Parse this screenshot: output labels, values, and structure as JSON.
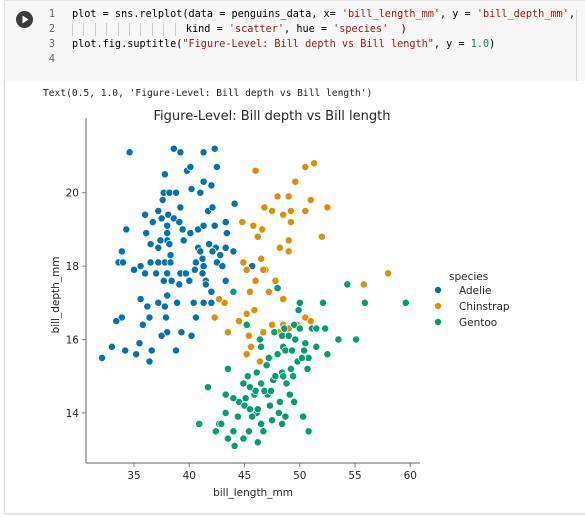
{
  "cell": {
    "run_icon": "play-circle-icon",
    "code_lines": [
      {
        "num": "1",
        "segments": [
          {
            "t": "plot = sns.relplot(data = penguins_data, x= ",
            "c": "kw"
          },
          {
            "t": "'bill_length_mm'",
            "c": "str"
          },
          {
            "t": ", y = ",
            "c": "kw"
          },
          {
            "t": "'bill_depth_mm'",
            "c": "str"
          },
          {
            "t": ",",
            "c": "kw"
          }
        ]
      },
      {
        "num": "2",
        "guides": 10,
        "segments": [
          {
            "t": "kind = ",
            "c": "kw"
          },
          {
            "t": "'scatter'",
            "c": "str"
          },
          {
            "t": ", hue = ",
            "c": "kw"
          },
          {
            "t": "'species'",
            "c": "str"
          },
          {
            "t": "  )",
            "c": "kw"
          }
        ]
      },
      {
        "num": "3",
        "segments": [
          {
            "t": "plot.fig.suptitle(",
            "c": "kw"
          },
          {
            "t": "\"Figure-Level: Bill depth vs Bill length\"",
            "c": "str"
          },
          {
            "t": ", y = ",
            "c": "kw"
          },
          {
            "t": "1.0",
            "c": "num"
          },
          {
            "t": ")",
            "c": "kw"
          }
        ]
      },
      {
        "num": "4",
        "segments": []
      }
    ],
    "output_text": "Text(0.5, 1.0, 'Figure-Level: Bill depth vs Bill length')"
  },
  "chart_data": {
    "type": "scatter",
    "title": "Figure-Level: Bill depth vs Bill length",
    "xlabel": "bill_length_mm",
    "ylabel": "bill_depth_mm",
    "xlim": [
      31.0,
      60.8
    ],
    "ylim": [
      12.7,
      22.0
    ],
    "xticks": [
      35,
      40,
      45,
      50,
      55,
      60
    ],
    "yticks": [
      14,
      16,
      18,
      20
    ],
    "grid": false,
    "legend": {
      "title": "species",
      "placement": "right"
    },
    "series": [
      {
        "name": "Adelie",
        "color": "#0173b2",
        "points": [
          [
            34.6,
            21.1
          ],
          [
            38.6,
            21.2
          ],
          [
            39.2,
            21.1
          ],
          [
            41.3,
            21.1
          ],
          [
            42.3,
            21.2
          ],
          [
            37.8,
            20.5
          ],
          [
            39.8,
            20.6
          ],
          [
            40.1,
            20.7
          ],
          [
            42.5,
            20.7
          ],
          [
            41.3,
            20.3
          ],
          [
            42.0,
            20.2
          ],
          [
            40.2,
            20.1
          ],
          [
            41.0,
            20.0
          ],
          [
            37.7,
            20.0
          ],
          [
            38.2,
            20.0
          ],
          [
            38.8,
            20.0
          ],
          [
            37.6,
            19.8
          ],
          [
            39.2,
            19.6
          ],
          [
            44.1,
            19.7
          ],
          [
            36.0,
            19.4
          ],
          [
            37.2,
            19.5
          ],
          [
            38.1,
            19.4
          ],
          [
            38.6,
            19.3
          ],
          [
            36.7,
            19.2
          ],
          [
            37.5,
            19.3
          ],
          [
            39.1,
            19.2
          ],
          [
            38.0,
            19.1
          ],
          [
            34.3,
            19.0
          ],
          [
            36.1,
            18.9
          ],
          [
            38.0,
            18.9
          ],
          [
            39.4,
            19.0
          ],
          [
            40.1,
            18.9
          ],
          [
            40.8,
            19.0
          ],
          [
            41.3,
            19.1
          ],
          [
            42.3,
            19.1
          ],
          [
            43.3,
            19.2
          ],
          [
            43.4,
            18.9
          ],
          [
            41.7,
            19.5
          ],
          [
            42.1,
            19.6
          ],
          [
            38.0,
            18.7
          ],
          [
            37.4,
            18.7
          ],
          [
            36.5,
            18.6
          ],
          [
            37.2,
            18.5
          ],
          [
            38.2,
            18.6
          ],
          [
            39.5,
            18.7
          ],
          [
            40.8,
            18.5
          ],
          [
            41.8,
            18.6
          ],
          [
            42.4,
            18.5
          ],
          [
            43.3,
            18.5
          ],
          [
            33.9,
            18.4
          ],
          [
            38.3,
            18.3
          ],
          [
            41.0,
            18.4
          ],
          [
            42.1,
            18.4
          ],
          [
            42.8,
            18.3
          ],
          [
            44.0,
            18.4
          ],
          [
            41.2,
            18.2
          ],
          [
            33.6,
            18.1
          ],
          [
            34.0,
            18.1
          ],
          [
            35.6,
            18.0
          ],
          [
            36.5,
            18.1
          ],
          [
            37.2,
            18.1
          ],
          [
            37.8,
            18.1
          ],
          [
            38.3,
            18.1
          ],
          [
            40.6,
            18.1
          ],
          [
            41.3,
            18.0
          ],
          [
            42.5,
            18.1
          ],
          [
            43.0,
            18.0
          ],
          [
            45.7,
            18.0
          ],
          [
            35.0,
            17.9
          ],
          [
            36.0,
            17.8
          ],
          [
            37.0,
            17.8
          ],
          [
            38.0,
            17.8
          ],
          [
            39.2,
            17.8
          ],
          [
            39.7,
            17.8
          ],
          [
            40.5,
            17.9
          ],
          [
            41.2,
            17.8
          ],
          [
            37.7,
            17.6
          ],
          [
            38.4,
            17.6
          ],
          [
            39.1,
            17.5
          ],
          [
            40.0,
            17.6
          ],
          [
            41.5,
            17.6
          ],
          [
            41.5,
            17.5
          ],
          [
            43.3,
            17.6
          ],
          [
            35.6,
            17.1
          ],
          [
            37.2,
            17.0
          ],
          [
            38.0,
            17.2
          ],
          [
            38.9,
            17.0
          ],
          [
            40.4,
            17.0
          ],
          [
            41.3,
            17.0
          ],
          [
            42.0,
            17.3
          ],
          [
            42.0,
            17.0
          ],
          [
            36.2,
            16.9
          ],
          [
            37.8,
            16.9
          ],
          [
            33.9,
            16.6
          ],
          [
            33.4,
            16.5
          ],
          [
            36.4,
            16.6
          ],
          [
            37.9,
            16.6
          ],
          [
            40.6,
            16.6
          ],
          [
            35.8,
            16.4
          ],
          [
            38.0,
            16.2
          ],
          [
            39.3,
            16.2
          ],
          [
            37.5,
            16.1
          ],
          [
            40.2,
            16.1
          ],
          [
            35.5,
            15.9
          ],
          [
            36.6,
            15.7
          ],
          [
            33.0,
            15.8
          ],
          [
            34.2,
            15.7
          ],
          [
            36.4,
            15.4
          ],
          [
            35.2,
            15.6
          ],
          [
            38.8,
            15.7
          ],
          [
            32.1,
            15.5
          ]
        ]
      },
      {
        "name": "Chinstrap",
        "color": "#de8f05",
        "points": [
          [
            51.3,
            20.8
          ],
          [
            46.0,
            20.6
          ],
          [
            50.5,
            20.7
          ],
          [
            49.6,
            20.3
          ],
          [
            48.0,
            19.9
          ],
          [
            49.0,
            19.9
          ],
          [
            51.0,
            19.8
          ],
          [
            50.5,
            19.5
          ],
          [
            52.5,
            19.6
          ],
          [
            46.8,
            19.6
          ],
          [
            47.5,
            19.5
          ],
          [
            44.8,
            19.2
          ],
          [
            49.2,
            19.5
          ],
          [
            48.5,
            19.4
          ],
          [
            45.8,
            19.1
          ],
          [
            46.6,
            19.0
          ],
          [
            49.2,
            19.2
          ],
          [
            46.2,
            18.8
          ],
          [
            49.0,
            18.7
          ],
          [
            48.2,
            18.5
          ],
          [
            49.0,
            18.4
          ],
          [
            46.5,
            18.2
          ],
          [
            44.9,
            18.1
          ],
          [
            46.9,
            17.9
          ],
          [
            46.7,
            17.9
          ],
          [
            45.2,
            17.9
          ],
          [
            46.0,
            17.6
          ],
          [
            47.8,
            17.6
          ],
          [
            47.2,
            17.3
          ],
          [
            45.5,
            17.3
          ],
          [
            48.5,
            17.1
          ],
          [
            43.2,
            17.0
          ],
          [
            50.0,
            17.0
          ],
          [
            42.7,
            17.1
          ],
          [
            45.9,
            16.8
          ],
          [
            44.5,
            16.5
          ],
          [
            50.5,
            16.6
          ],
          [
            48.5,
            16.4
          ],
          [
            49.8,
            16.4
          ],
          [
            49.0,
            16.3
          ],
          [
            48.1,
            16.2
          ],
          [
            45.4,
            16.1
          ],
          [
            42.3,
            16.6
          ],
          [
            43.5,
            16.2
          ],
          [
            45.2,
            16.7
          ],
          [
            46.7,
            16.2
          ],
          [
            47.5,
            16.4
          ],
          [
            51.0,
            16.5
          ],
          [
            58.0,
            17.8
          ],
          [
            55.8,
            17.5
          ],
          [
            52.0,
            18.8
          ],
          [
            45.6,
            15.8
          ],
          [
            45.2,
            15.6
          ],
          [
            46.4,
            15.4
          ]
        ]
      },
      {
        "name": "Gentoo",
        "color": "#029e73",
        "points": [
          [
            59.6,
            17.0
          ],
          [
            55.9,
            17.0
          ],
          [
            50.0,
            17.0
          ],
          [
            49.9,
            16.8
          ],
          [
            54.3,
            17.5
          ],
          [
            48.0,
            17.4
          ],
          [
            44.0,
            17.3
          ],
          [
            52.3,
            16.3
          ],
          [
            46.4,
            16.0
          ],
          [
            48.0,
            15.6
          ],
          [
            48.5,
            15.8
          ],
          [
            48.6,
            16.3
          ],
          [
            49.5,
            16.4
          ],
          [
            49.8,
            15.4
          ],
          [
            50.8,
            15.5
          ],
          [
            51.5,
            15.8
          ],
          [
            50.2,
            15.5
          ],
          [
            49.2,
            15.2
          ],
          [
            46.5,
            15.8
          ],
          [
            47.3,
            15.5
          ],
          [
            48.4,
            15.1
          ],
          [
            49.4,
            15.0
          ],
          [
            50.7,
            15.2
          ],
          [
            48.8,
            14.8
          ],
          [
            47.1,
            14.5
          ],
          [
            48.2,
            14.3
          ],
          [
            49.5,
            14.3
          ],
          [
            46.5,
            14.8
          ],
          [
            45.5,
            14.7
          ],
          [
            45.9,
            14.5
          ],
          [
            46.8,
            14.6
          ],
          [
            47.3,
            14.2
          ],
          [
            44.5,
            14.3
          ],
          [
            43.5,
            15.2
          ],
          [
            44.4,
            13.9
          ],
          [
            43.3,
            14.0
          ],
          [
            45.0,
            14.2
          ],
          [
            45.5,
            14.1
          ],
          [
            46.1,
            14.0
          ],
          [
            46.5,
            13.7
          ],
          [
            46.7,
            13.5
          ],
          [
            47.5,
            13.8
          ],
          [
            48.1,
            14.0
          ],
          [
            48.4,
            13.7
          ],
          [
            48.7,
            13.9
          ],
          [
            50.3,
            13.9
          ],
          [
            50.8,
            13.5
          ],
          [
            45.4,
            13.5
          ],
          [
            44.0,
            13.5
          ],
          [
            42.7,
            13.7
          ],
          [
            42.4,
            13.5
          ],
          [
            43.5,
            13.3
          ],
          [
            44.1,
            13.1
          ],
          [
            46.2,
            13.2
          ],
          [
            46.0,
            14.6
          ],
          [
            47.0,
            15.3
          ],
          [
            45.3,
            15.0
          ],
          [
            44.9,
            14.8
          ],
          [
            47.6,
            14.9
          ],
          [
            49.6,
            16.0
          ],
          [
            51.1,
            16.3
          ],
          [
            48.4,
            16.1
          ],
          [
            47.7,
            16.2
          ],
          [
            45.1,
            14.4
          ],
          [
            44.0,
            14.4
          ],
          [
            41.7,
            14.7
          ],
          [
            43.3,
            14.5
          ],
          [
            42.9,
            13.7
          ],
          [
            40.9,
            13.7
          ],
          [
            46.1,
            15.1
          ],
          [
            47.8,
            15.0
          ],
          [
            45.2,
            16.4
          ],
          [
            46.2,
            14.1
          ],
          [
            52.1,
            17.0
          ],
          [
            51.5,
            16.3
          ],
          [
            55.1,
            16.0
          ],
          [
            53.5,
            16.0
          ],
          [
            44.9,
            13.3
          ],
          [
            45.7,
            13.9
          ],
          [
            47.4,
            14.6
          ],
          [
            49.1,
            14.5
          ],
          [
            50.4,
            15.7
          ],
          [
            50.5,
            15.9
          ],
          [
            49.0,
            16.1
          ],
          [
            50.0,
            16.3
          ],
          [
            48.7,
            15.7
          ],
          [
            52.5,
            15.6
          ],
          [
            49.3,
            15.7
          ],
          [
            48.5,
            15.0
          ],
          [
            47.2,
            15.5
          ]
        ]
      }
    ]
  }
}
